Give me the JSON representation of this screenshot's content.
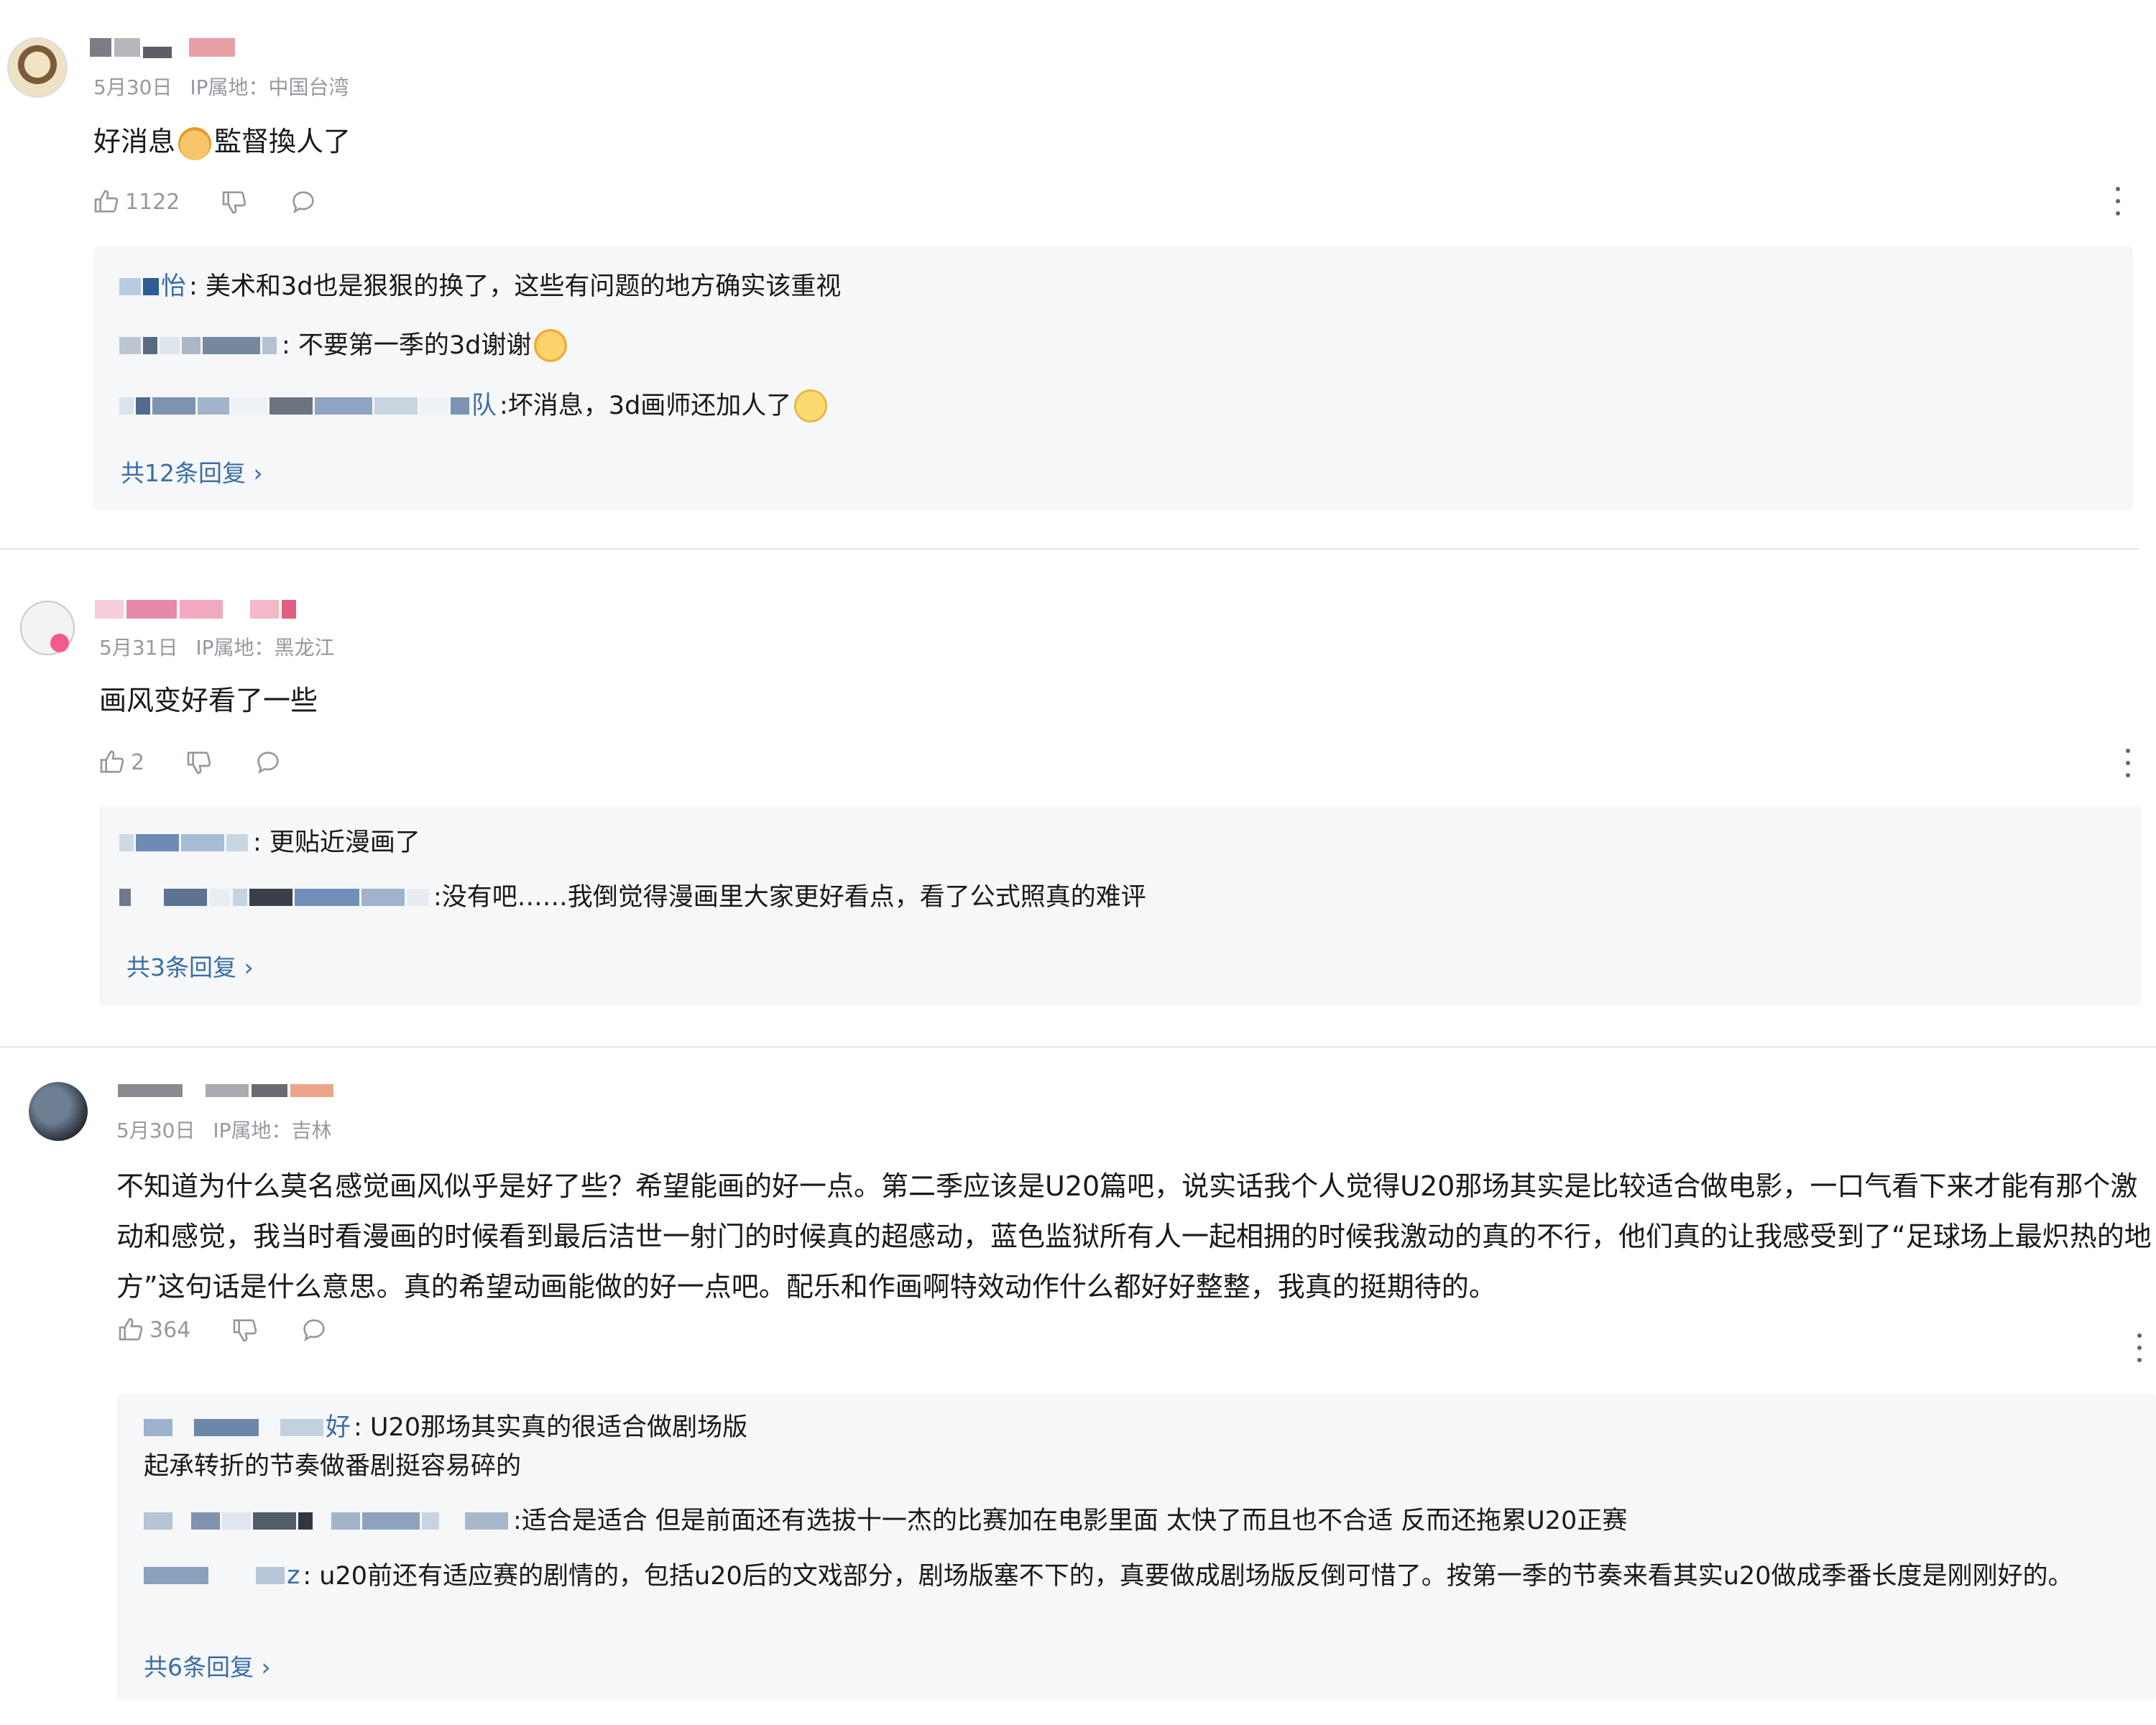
{
  "comments": [
    {
      "date": "5月30日",
      "ip": "IP属地：中国台湾",
      "content_a": "好消息",
      "content_b": "監督換人了",
      "likes": "1122",
      "replies": [
        {
          "name_tail": "怡",
          "text": ": 美术和3d也是狠狠的换了，这些有问题的地方确实该重视"
        },
        {
          "name_tail": "",
          "text": ": 不要第一季的3d谢谢"
        },
        {
          "name_tail": "队",
          "text": " :坏消息，3d画师还加人了"
        }
      ],
      "more": "共12条回复 ›"
    },
    {
      "date": "5月31日",
      "ip": "IP属地：黑龙江",
      "content": "画风变好看了一些",
      "likes": "2",
      "replies": [
        {
          "text": ": 更贴近漫画了"
        },
        {
          "text": " :没有吧……我倒觉得漫画里大家更好看点，看了公式照真的难评"
        }
      ],
      "more": "共3条回复 ›"
    },
    {
      "date": "5月30日",
      "ip": "IP属地：吉林",
      "content": "不知道为什么莫名感觉画风似乎是好了些？希望能画的好一点。第二季应该是U20篇吧，说实话我个人觉得U20那场其实是比较适合做电影，一口气看下来才能有那个激动和感觉，我当时看漫画的时候看到最后洁世一射门的时候真的超感动，蓝色监狱所有人一起相拥的时候我激动的真的不行，他们真的让我感受到了“足球场上最炽热的地方”这句话是什么意思。真的希望动画能做的好一点吧。配乐和作画啊特效动作什么都好好整整，我真的挺期待的。",
      "likes": "364",
      "replies": [
        {
          "name_tail": "好",
          "text": ": U20那场其实真的很适合做剧场版",
          "text2": "起承转折的节奏做番剧挺容易碎的"
        },
        {
          "text": " :适合是适合 但是前面还有选拔十一杰的比赛加在电影里面 太快了而且也不合适 反而还拖累U20正赛"
        },
        {
          "name_tail": "z",
          "text": ": u20前还有适应赛的剧情的，包括u20后的文戏部分，剧场版塞不下的，真要做成剧场版反倒可惜了。按第一季的节奏来看其实u20做成季番长度是刚刚好的。"
        }
      ],
      "more": "共6条回复 ›"
    }
  ],
  "colors": {
    "link": "#3b6ea5",
    "meta": "#9499a0",
    "reply_bg": "#f6f7f8",
    "divider": "#e3e5e7"
  },
  "icons": [
    "thumbs-up-icon",
    "thumbs-down-icon",
    "reply-bubble-icon",
    "more-vertical-icon",
    "cat-emoji-icon",
    "laugh-cry-emoji-icon",
    "smile-emoji-icon"
  ]
}
